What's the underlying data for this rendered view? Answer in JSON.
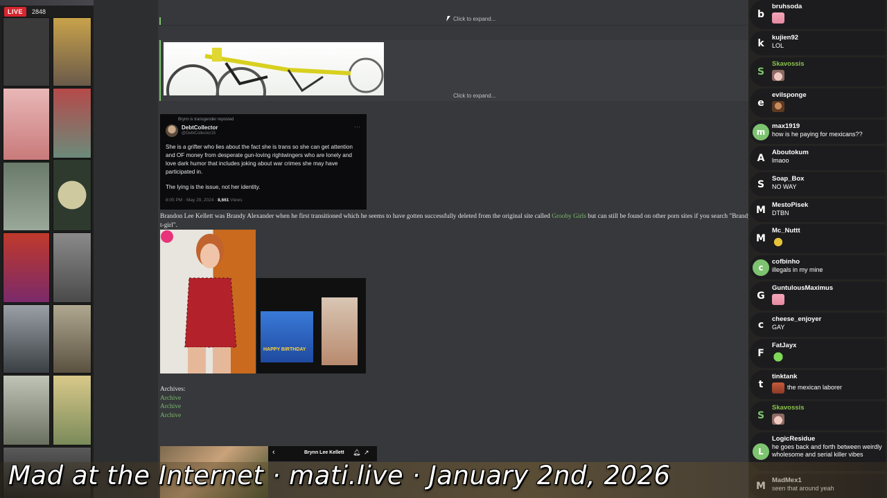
{
  "stream": {
    "live_label": "LIVE",
    "viewer_count": "2848"
  },
  "article": {
    "expand_label_1": "Click to expand...",
    "expand_label_2": "Click to expand...",
    "tweet": {
      "repost_label": "Brynn is transgender reposted",
      "author": "DebtCollector",
      "handle": "@DebtCollector15",
      "more": "···",
      "body": "She is a grifter who lies about the fact she is trans so she can get attention and OF money from desperate gun-loving rightwingers who are lonely and love dark humor that includes joking about war crimes she may have participated in.",
      "body2": "The lying is the issue, not her identity.",
      "time": "8:05 PM · May 29, 2024 · ",
      "views_count": "8,661",
      "views_label": " Views"
    },
    "paragraph_before_link": "Brandon Lee Kellett was Brandy Alexander when he first transitioned which he seems to have gotten successfully deleted from the original site called ",
    "paragraph_link": "Grooby Girls",
    "paragraph_after_link": " but can still be found on other porn sites if you search \"Brandy Alexander t-girl\".",
    "archives_label": "Archives:",
    "archive_links": [
      "Archive",
      "Archive",
      "Archive"
    ],
    "phone_title": "Brynn Lee Kellett",
    "card_text": "HAPPY BIRTHDAY"
  },
  "chat": {
    "messages": [
      {
        "initial": "b",
        "user": "bruhsoda",
        "text": "",
        "emote": "e-pink"
      },
      {
        "initial": "k",
        "user": "kujien92",
        "text": "LOL",
        "emote": ""
      },
      {
        "initial": "S",
        "user": "Skavossis",
        "text": "",
        "emote": "e-cat",
        "green": true
      },
      {
        "initial": "e",
        "user": "evilsponge",
        "text": "",
        "emote": "e-face"
      },
      {
        "initial": "m",
        "user": "max1919",
        "text": "how is he paying for mexicans??",
        "emote": "",
        "circle": true
      },
      {
        "initial": "A",
        "user": "Aboutokum",
        "text": "lmaoo",
        "emote": ""
      },
      {
        "initial": "S",
        "user": "Soap_Box",
        "text": "NO WAY",
        "emote": ""
      },
      {
        "initial": "M",
        "user": "MestoPisek",
        "text": "DTBN",
        "emote": ""
      },
      {
        "initial": "M",
        "user": "Mc_Nuttt",
        "text": "",
        "emote": "e-gold"
      },
      {
        "initial": "c",
        "user": "cofbinho",
        "text": "illegals in my mine",
        "emote": "",
        "circle": true
      },
      {
        "initial": "G",
        "user": "GuntulousMaximus",
        "text": "",
        "emote": "e-pink"
      },
      {
        "initial": "c",
        "user": "cheese_enjoyer",
        "text": "GAY",
        "emote": ""
      },
      {
        "initial": "F",
        "user": "FatJayx",
        "text": "",
        "emote": "e-green"
      },
      {
        "initial": "t",
        "user": "tinktank",
        "text": "the mexican laborer",
        "emote": "e-red"
      },
      {
        "initial": "S",
        "user": "Skavossis",
        "text": "",
        "emote": "e-cat",
        "green": true
      },
      {
        "initial": "L",
        "user": "LogicResidue",
        "text": "he goes back and forth between weirdly wholesome and serial killer vibes",
        "emote": "",
        "circle": true
      },
      {
        "initial": "M",
        "user": "MadMex1",
        "text": "seen that around yeah",
        "emote": ""
      }
    ]
  },
  "caption": "Mad at the Internet · mati.live · January 2nd, 2026",
  "colors": {
    "accent_green": "#7dc370",
    "live_red": "#d6262f"
  }
}
